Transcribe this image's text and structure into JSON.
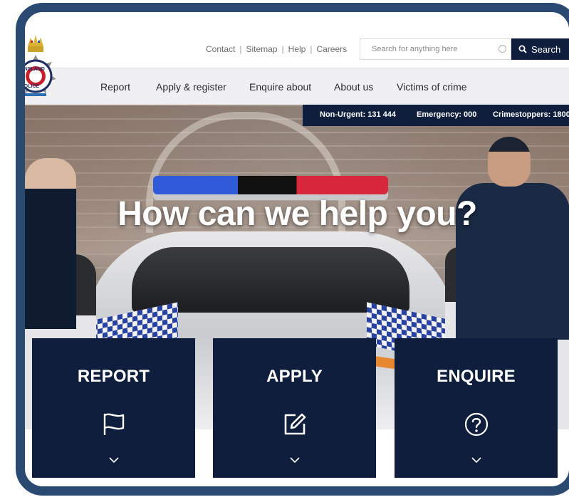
{
  "utility": {
    "links": [
      "Contact",
      "Sitemap",
      "Help",
      "Careers"
    ],
    "search_placeholder": "Search for anything here",
    "search_button": "Search"
  },
  "nav": {
    "items": [
      "Report",
      "Apply & register",
      "Enquire about",
      "About us",
      "Victims of crime"
    ]
  },
  "logo": {
    "text": "QUEENSLAND POLICE"
  },
  "emergency": {
    "non_urgent": "Non-Urgent: 131 444",
    "emergency": "Emergency: 000",
    "crimestoppers": "Crimestoppers: 1800"
  },
  "hero": {
    "title": "How can we help you?"
  },
  "cards": [
    {
      "title": "REPORT",
      "icon": "flag-icon"
    },
    {
      "title": "APPLY",
      "icon": "edit-icon"
    },
    {
      "title": "ENQUIRE",
      "icon": "question-icon"
    }
  ],
  "colors": {
    "navy": "#0f1e3c",
    "frame": "#2a4a72",
    "nav_bg": "#f0f0f2"
  }
}
